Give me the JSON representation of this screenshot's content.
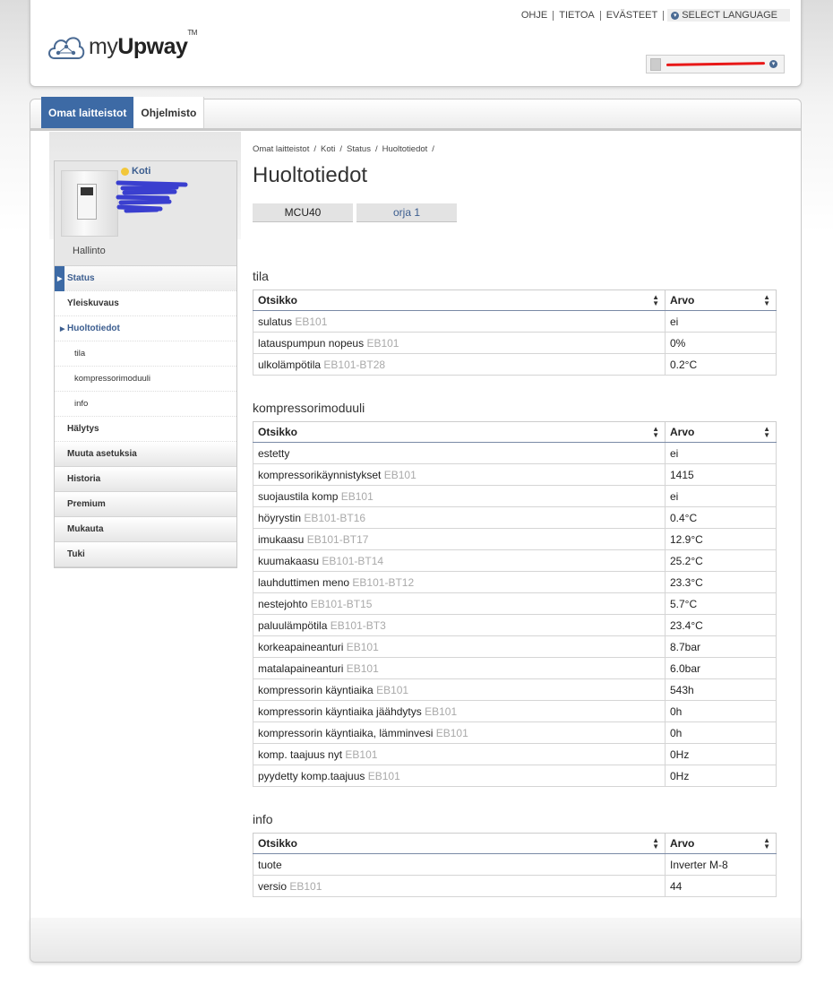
{
  "header": {
    "links": [
      "OHJE",
      "TIETOA",
      "EVÄSTEET"
    ],
    "language_label": "SELECT LANGUAGE",
    "logo_prefix": "my",
    "logo_brand": "Upway",
    "logo_tm": "TM"
  },
  "tabs": [
    {
      "label": "Omat laitteistot",
      "active": true
    },
    {
      "label": "Ohjelmisto",
      "active": false
    }
  ],
  "device": {
    "name": "Koti",
    "footer": "Hallinto"
  },
  "sidebar": {
    "items": [
      {
        "label": "Status"
      },
      {
        "label": "Yleiskuvaus"
      },
      {
        "label": "Huoltotiedot"
      },
      {
        "label": "tila"
      },
      {
        "label": "kompressorimoduuli"
      },
      {
        "label": "info"
      },
      {
        "label": "Hälytys"
      },
      {
        "label": "Muuta asetuksia"
      },
      {
        "label": "Historia"
      },
      {
        "label": "Premium"
      },
      {
        "label": "Mukauta"
      },
      {
        "label": "Tuki"
      }
    ]
  },
  "breadcrumb": [
    "Omat laitteistot",
    "/",
    "Koti",
    "/",
    "Status",
    "/",
    "Huoltotiedot",
    "/"
  ],
  "page_title": "Huoltotiedot",
  "subtabs": [
    "MCU40",
    "orja 1"
  ],
  "col_header_title": "Otsikko",
  "col_header_value": "Arvo",
  "sections": {
    "tila": {
      "title": "tila",
      "rows": [
        {
          "label": "sulatus",
          "tag": "EB101",
          "value": "ei"
        },
        {
          "label": "latauspumpun nopeus",
          "tag": "EB101",
          "value": "0%"
        },
        {
          "label": "ulkolämpötila",
          "tag": "EB101-BT28",
          "value": "0.2°C"
        }
      ]
    },
    "kompressorimoduuli": {
      "title": "kompressorimoduuli",
      "rows": [
        {
          "label": "estetty",
          "tag": "",
          "value": "ei"
        },
        {
          "label": "kompressorikäynnistykset",
          "tag": "EB101",
          "value": "1415"
        },
        {
          "label": "suojaustila komp",
          "tag": "EB101",
          "value": "ei"
        },
        {
          "label": "höyrystin",
          "tag": "EB101-BT16",
          "value": "0.4°C"
        },
        {
          "label": "imukaasu",
          "tag": "EB101-BT17",
          "value": "12.9°C"
        },
        {
          "label": "kuumakaasu",
          "tag": "EB101-BT14",
          "value": "25.2°C"
        },
        {
          "label": "lauhduttimen meno",
          "tag": "EB101-BT12",
          "value": "23.3°C"
        },
        {
          "label": "nestejohto",
          "tag": "EB101-BT15",
          "value": "5.7°C"
        },
        {
          "label": "paluulämpötila",
          "tag": "EB101-BT3",
          "value": "23.4°C"
        },
        {
          "label": "korkeapaineanturi",
          "tag": "EB101",
          "value": "8.7bar"
        },
        {
          "label": "matalapaineanturi",
          "tag": "EB101",
          "value": "6.0bar"
        },
        {
          "label": "kompressorin käyntiaika",
          "tag": "EB101",
          "value": "543h"
        },
        {
          "label": "kompressorin käyntiaika jäähdytys",
          "tag": "EB101",
          "value": "0h"
        },
        {
          "label": "kompressorin käyntiaika, lämminvesi",
          "tag": "EB101",
          "value": "0h"
        },
        {
          "label": "komp. taajuus nyt",
          "tag": "EB101",
          "value": "0Hz"
        },
        {
          "label": "pyydetty komp.taajuus",
          "tag": "EB101",
          "value": "0Hz"
        }
      ]
    },
    "info": {
      "title": "info",
      "rows": [
        {
          "label": "tuote",
          "tag": "",
          "value": "Inverter M-8"
        },
        {
          "label": "versio",
          "tag": "EB101",
          "value": "44"
        }
      ]
    }
  },
  "colors": {
    "accent": "#3d6aa5",
    "tag_gray": "#a9a9a9",
    "status_dot": "#f2c73a"
  }
}
